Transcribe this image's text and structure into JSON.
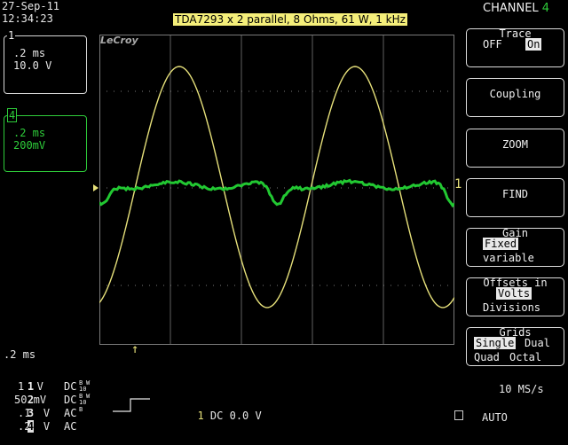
{
  "header": {
    "date": "27-Sep-11",
    "time": "12:34:23",
    "trace_label": "TDA7293 x 2 parallel, 8 Ohms, 61 W, 1 kHz",
    "brand": "LeCroy",
    "menu_title": "CHANNEL",
    "menu_channel": "4"
  },
  "channels_left": [
    {
      "id": "1",
      "timebase": ".2 ms",
      "scale": "10.0 V",
      "color": "#f0f0f0"
    },
    {
      "id": "4",
      "timebase": ".2 ms",
      "scale": "200mV",
      "color": "#2ecc3a"
    }
  ],
  "bottom": {
    "timebase": ".2 ms",
    "rows": [
      {
        "ch": "1",
        "val": "1  V",
        "coupling": "DC"
      },
      {
        "ch": "2",
        "val": "50 mV",
        "coupling": "DC"
      },
      {
        "ch": "3",
        "val": ".1  V",
        "coupling": "AC"
      },
      {
        "ch": "4",
        "val": ".2  V",
        "coupling": "AC"
      }
    ],
    "trigger_ch": "1",
    "trigger_desc": "DC 0.0 V",
    "sample_rate": "10 MS/s",
    "mode": "AUTO"
  },
  "menu": {
    "trace": {
      "title": "Trace",
      "off": "OFF",
      "on": "On"
    },
    "coupling": "Coupling",
    "zoom": "ZOOM",
    "find": "FIND",
    "gain": {
      "title": "Gain",
      "fixed": "Fixed",
      "variable": "variable"
    },
    "offsets": {
      "title": "Offsets in",
      "volts": "Volts",
      "divisions": "Divisions"
    },
    "grids": {
      "title": "Grids",
      "single": "Single",
      "dual": "Dual",
      "quad": "Quad",
      "octal": "Octal"
    }
  },
  "colors": {
    "yellow_trace": "#e6e07a",
    "green_trace": "#22c832",
    "grid": "#7a7a7a",
    "label_bg": "#f5ef7a"
  }
}
